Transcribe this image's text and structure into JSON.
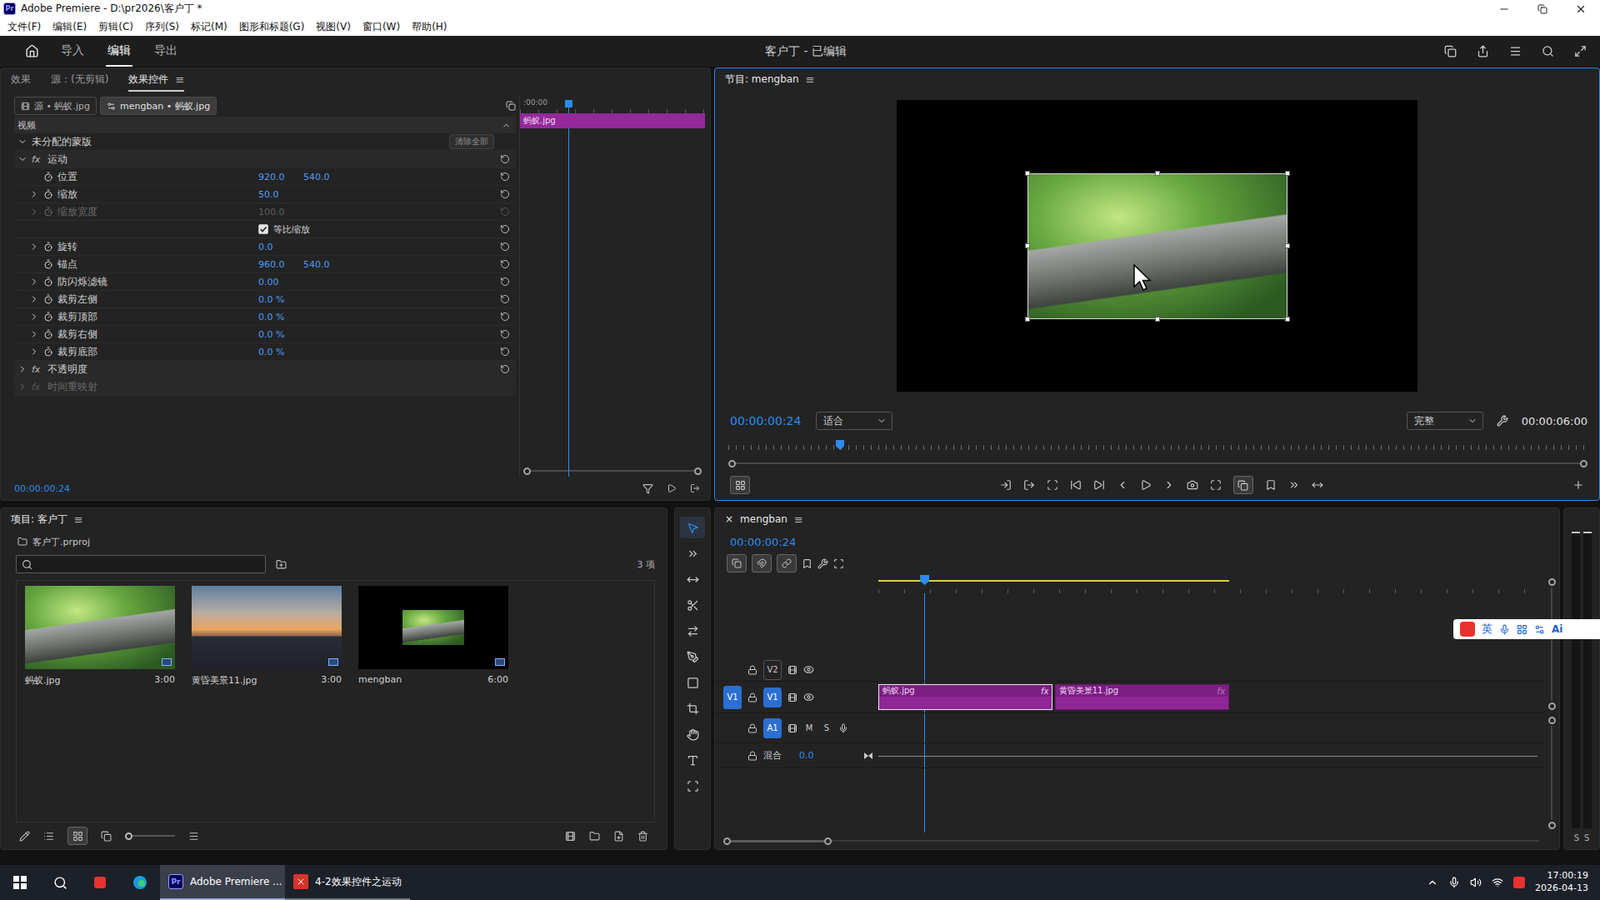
{
  "window": {
    "logo": "Pr",
    "title": "Adobe Premiere - D:\\pr2026\\客户丁 *"
  },
  "menu": [
    "文件(F)",
    "编辑(E)",
    "剪辑(C)",
    "序列(S)",
    "标记(M)",
    "图形和标题(G)",
    "视图(V)",
    "窗口(W)",
    "帮助(H)"
  ],
  "header": {
    "tabs": [
      {
        "label": "导入",
        "selected": false
      },
      {
        "label": "编辑",
        "selected": true
      },
      {
        "label": "导出",
        "selected": false
      }
    ],
    "project_title": "客户丁 - 已编辑"
  },
  "effect_panel": {
    "focused": false,
    "menu_glyph": "≡",
    "tabs": [
      {
        "label": "效果",
        "selected": false
      },
      {
        "label": "源：(无剪辑)",
        "selected": false
      },
      {
        "label": "效果控件",
        "selected": true
      }
    ],
    "clip_tabs": [
      {
        "label": "源 • 蚂蚁.jpg",
        "selected": false
      },
      {
        "label": "mengban • 蚂蚁.jpg",
        "selected": true
      }
    ],
    "section": "视频",
    "mask": {
      "label": "未分配的蒙版",
      "button": "清除全部",
      "expanded": true
    },
    "rows": [
      {
        "kind": "group",
        "label": "运动",
        "badge": "fx",
        "expanded": true,
        "disabled": false
      },
      {
        "kind": "param",
        "label": "位置",
        "values": [
          "920.0",
          "540.0"
        ],
        "expandable": false,
        "disabled": false
      },
      {
        "kind": "param",
        "label": "缩放",
        "values": [
          "50.0"
        ],
        "expandable": true,
        "disabled": false
      },
      {
        "kind": "param",
        "label": "缩放宽度",
        "values": [
          "100.0"
        ],
        "expandable": true,
        "disabled": true
      },
      {
        "kind": "checkbox",
        "label": "等比缩放",
        "checked": true
      },
      {
        "kind": "param",
        "label": "旋转",
        "values": [
          "0.0"
        ],
        "expandable": true,
        "disabled": false
      },
      {
        "kind": "param",
        "label": "锚点",
        "values": [
          "960.0",
          "540.0"
        ],
        "expandable": false,
        "disabled": false
      },
      {
        "kind": "param",
        "label": "防闪烁滤镜",
        "values": [
          "0.00"
        ],
        "expandable": true,
        "disabled": false
      },
      {
        "kind": "param",
        "label": "裁剪左侧",
        "values": [
          "0.0 %"
        ],
        "expandable": true,
        "disabled": false
      },
      {
        "kind": "param",
        "label": "裁剪顶部",
        "values": [
          "0.0 %"
        ],
        "expandable": true,
        "disabled": false
      },
      {
        "kind": "param",
        "label": "裁剪右侧",
        "values": [
          "0.0 %"
        ],
        "expandable": true,
        "disabled": false
      },
      {
        "kind": "param",
        "label": "裁剪底部",
        "values": [
          "0.0 %"
        ],
        "expandable": true,
        "disabled": false
      },
      {
        "kind": "group",
        "label": "不透明度",
        "badge": "fx",
        "expanded": false,
        "disabled": false
      },
      {
        "kind": "group",
        "label": "时间重映射",
        "badge": "fx",
        "expanded": false,
        "disabled": true
      }
    ],
    "mini_timeline": {
      "start": ":00:00",
      "clip": "蚂蚁.jpg",
      "playhead": 0.26
    },
    "time": "00:00:00:24"
  },
  "program": {
    "focused": true,
    "title": "节目: mengban",
    "menu_glyph": "≡",
    "time": "00:00:00:24",
    "zoom": "适合",
    "quality": "完整",
    "duration": "00:00:06:00",
    "playhead": 0.13
  },
  "project": {
    "focused": false,
    "title": "项目: 客户丁",
    "menu_glyph": "≡",
    "file": "客户丁.prproj",
    "count": "3 项",
    "items": [
      {
        "name": "蚂蚁.jpg",
        "duration": "3:00",
        "thumb": "ant"
      },
      {
        "name": "黄昏美景11.jpg",
        "duration": "3:00",
        "thumb": "sunset"
      },
      {
        "name": "mengban",
        "duration": "6:00",
        "thumb": "sequence"
      }
    ]
  },
  "tools": [
    {
      "kind": "select",
      "selected": true
    },
    {
      "kind": "track-select",
      "selected": false
    },
    {
      "kind": "ripple",
      "selected": false
    },
    {
      "kind": "razor",
      "selected": false
    },
    {
      "kind": "slip",
      "selected": false
    },
    {
      "kind": "pen",
      "selected": false
    },
    {
      "kind": "rectangle",
      "selected": false
    },
    {
      "kind": "frame",
      "selected": false
    },
    {
      "kind": "hand",
      "selected": false
    },
    {
      "kind": "type",
      "selected": false
    },
    {
      "kind": "caption",
      "selected": false
    }
  ],
  "timeline": {
    "focused": false,
    "close": "×",
    "title": "mengban",
    "menu_glyph": "≡",
    "time": "00:00:00:24",
    "playhead": 0.069,
    "work_area": {
      "start": 0,
      "end": 0.527
    },
    "tracks": [
      {
        "name": "V2",
        "kind": "video",
        "source": null,
        "targeted": false
      },
      {
        "name": "V1",
        "kind": "video",
        "source": "V1",
        "targeted": true
      },
      {
        "name": "A1",
        "kind": "audio",
        "source": null,
        "targeted": true,
        "buttons": [
          "M",
          "S"
        ]
      }
    ],
    "mix": {
      "label": "混合",
      "value": "0.0"
    },
    "clips": [
      {
        "track": "V1",
        "name": "蚂蚁.jpg",
        "badge": "fx",
        "start": 0,
        "end": 0.262,
        "selected": true
      },
      {
        "track": "V1",
        "name": "黄昏美景11.jpg",
        "badge": "fx",
        "start": 0.265,
        "end": 0.527,
        "selected": false
      }
    ]
  },
  "meter": {
    "labels": [
      "S",
      "S"
    ]
  },
  "ime_bar": {
    "lang": "英",
    "badge": "Ai"
  },
  "taskbar": {
    "apps": [
      {
        "label": "Adobe Premiere ...",
        "logo": "Pr",
        "kind": "premiere",
        "active": true
      },
      {
        "label": "4-2效果控件之运动",
        "kind": "doc",
        "active": false
      }
    ],
    "time": "17:00:19",
    "date": "2026-04-13"
  }
}
